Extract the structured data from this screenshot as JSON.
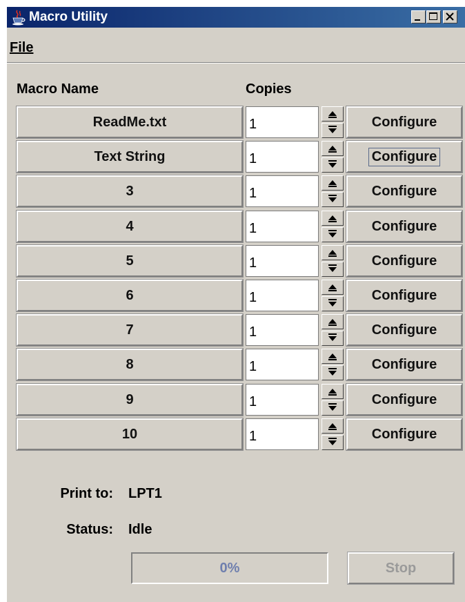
{
  "window": {
    "title": "Macro Utility",
    "title_icon": "java-cup-icon"
  },
  "menu": {
    "file_label": "File"
  },
  "headers": {
    "macro_name": "Macro Name",
    "copies": "Copies"
  },
  "rows": [
    {
      "name": "ReadMe.txt",
      "copies": "1",
      "configure": "Configure"
    },
    {
      "name": "Text String",
      "copies": "1",
      "configure": "Configure"
    },
    {
      "name": "3",
      "copies": "1",
      "configure": "Configure"
    },
    {
      "name": "4",
      "copies": "1",
      "configure": "Configure"
    },
    {
      "name": "5",
      "copies": "1",
      "configure": "Configure"
    },
    {
      "name": "6",
      "copies": "1",
      "configure": "Configure"
    },
    {
      "name": "7",
      "copies": "1",
      "configure": "Configure"
    },
    {
      "name": "8",
      "copies": "1",
      "configure": "Configure"
    },
    {
      "name": "9",
      "copies": "1",
      "configure": "Configure"
    },
    {
      "name": "10",
      "copies": "1",
      "configure": "Configure"
    }
  ],
  "info": {
    "print_to_label": "Print to:",
    "print_to_value": "LPT1",
    "status_label": "Status:",
    "status_value": "Idle"
  },
  "progress": {
    "text": "0%",
    "value": 0
  },
  "stop_label": "Stop",
  "colors": {
    "titlebar": "#0a246a",
    "face": "#d4d0c8",
    "progress_text": "#6f7fae"
  }
}
